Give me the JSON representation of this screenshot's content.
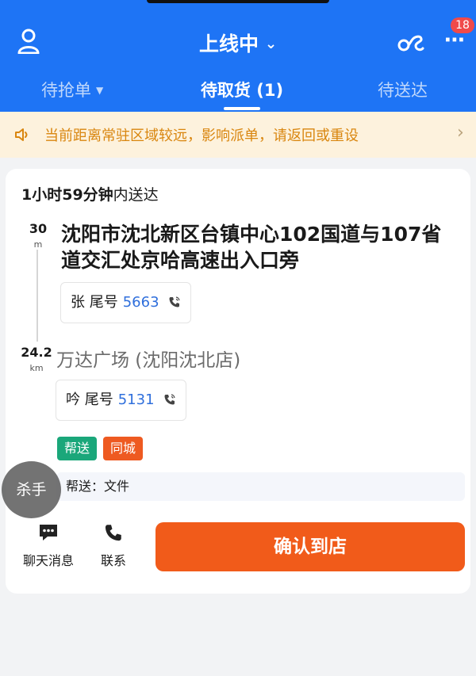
{
  "header": {
    "status_title": "上线中",
    "badge_count": "18",
    "tabs": [
      {
        "label": "待抢单",
        "active": false
      },
      {
        "label": "待取货 (1)",
        "active": true
      },
      {
        "label": "待送达",
        "active": false
      }
    ]
  },
  "notice": {
    "text": "当前距离常驻区域较远，影响派单，请返回或重设"
  },
  "order": {
    "deadline_strong": "1小时59分钟",
    "deadline_suffix": "内送达",
    "pickup": {
      "distance": "30",
      "unit": "m",
      "address": "沈阳市沈北新区台镇中心102国道与107省道交汇处京哈高速出入口旁",
      "contact_label": "张 尾号",
      "contact_digits": "5663"
    },
    "dropoff": {
      "distance": "24.2",
      "unit": "km",
      "address": "万达广场 (沈阳沈北店)",
      "contact_label": "吟 尾号",
      "contact_digits": "5131"
    },
    "tags": [
      {
        "label": "帮送",
        "color": "#1aa77a"
      },
      {
        "label": "同城",
        "color": "#ee5a21"
      }
    ],
    "note": "帮送：文件"
  },
  "overlay_bubble": "杀手",
  "actions": {
    "chat_label": "聊天消息",
    "call_label": "联系",
    "confirm_label": "确认到店"
  },
  "colors": {
    "brand_blue": "#1e74f5",
    "confirm_orange": "#f15b1a",
    "notice_bg": "#fdf2dd",
    "notice_text": "#d9860f"
  }
}
